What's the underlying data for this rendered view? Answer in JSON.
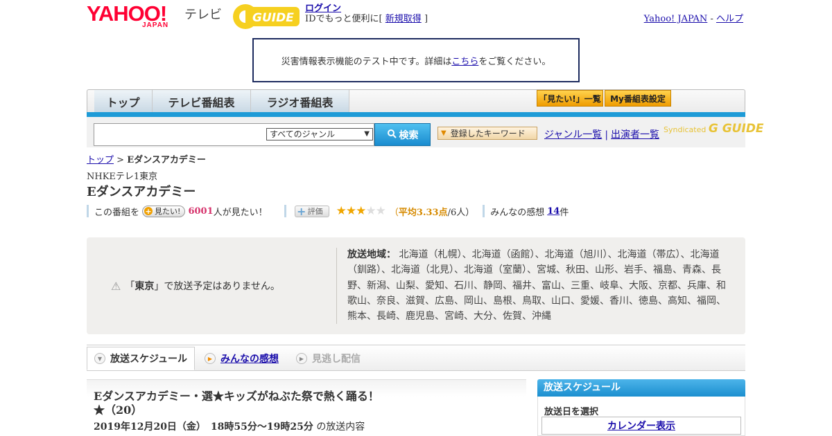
{
  "header": {
    "yahoo_logo": "YAHOO!",
    "yahoo_sub": "JAPAN",
    "tv_label": "テレビ",
    "guide_logo": "GUIDE",
    "login": "ログイン",
    "id_prefix": "IDでもっと便利に[",
    "register": "新規取得",
    "id_suffix": "]",
    "yahoo_japan_link": "Yahoo! JAPAN",
    "dash": "-",
    "help_link": "ヘルプ"
  },
  "notice": {
    "before": "災害情報表示機能のテスト中です。詳細は",
    "link": "こちら",
    "after": "をご覧ください。"
  },
  "nav": {
    "tabs": [
      "トップ",
      "テレビ番組表",
      "ラジオ番組表"
    ],
    "want_list": "「見たい!」一覧",
    "my_schedule": "My番組表設定"
  },
  "search": {
    "input_value": "",
    "genre_selected": "すべてのジャンル",
    "search_button": "検索",
    "keyword_button": "登録したキーワード",
    "genre_list": "ジャンル一覧",
    "separator": "|",
    "performer_list": "出演者一覧",
    "syndicated": "Syndicated",
    "syndicated_logo": "G GUIDE"
  },
  "breadcrumb": {
    "top": "トップ",
    "sep": ">",
    "current": "Eダンスアカデミー"
  },
  "program": {
    "channel": "NHKEテレ1東京",
    "title": "Eダンスアカデミー",
    "want_prefix": "この番組を",
    "want_button": "見たい!",
    "want_count": "6001",
    "want_suffix": "人が見たい！",
    "rate_button": "評価",
    "rating": 3,
    "rating_max": 5,
    "avg_open": "（",
    "avg_text": "平均3.33点",
    "avg_people": "/6人）",
    "impressions_label": "みんなの感想",
    "impressions_count": "14",
    "impressions_unit": "件"
  },
  "broadcast": {
    "no_broadcast_open": "「",
    "region": "東京",
    "no_broadcast_close": "」で放送予定はありません。",
    "areas_label": "放送地域：",
    "areas_text": "北海道（札幌）、北海道（函館）、北海道（旭川）、北海道（帯広）、北海道（釧路）、北海道（北見）、北海道（室蘭）、宮城、秋田、山形、岩手、福島、青森、長野、新潟、山梨、愛知、石川、静岡、福井、富山、三重、岐阜、大阪、京都、兵庫、和歌山、奈良、滋賀、広島、岡山、島根、鳥取、山口、愛媛、香川、徳島、高知、福岡、熊本、長崎、鹿児島、宮崎、大分、佐賀、沖縄"
  },
  "tabs": {
    "schedule": "放送スケジュール",
    "impressions": "みんなの感想",
    "missed": "見逃し配信"
  },
  "episode": {
    "title": "Eダンスアカデミー・選★キッズがねぶた祭で熱く踊る！★（20）",
    "date": "2019年12月20日（金）　18時55分～19時25分",
    "date_suffix": "の放送内容"
  },
  "sidebar": {
    "heading": "放送スケジュール",
    "select_date": "放送日を選択",
    "calendar": "カレンダー表示"
  },
  "colors": {
    "accent_blue": "#1e9bd7",
    "orange": "#ef9c00",
    "yahoo_red": "#ff0033",
    "star": "#f0a600"
  }
}
